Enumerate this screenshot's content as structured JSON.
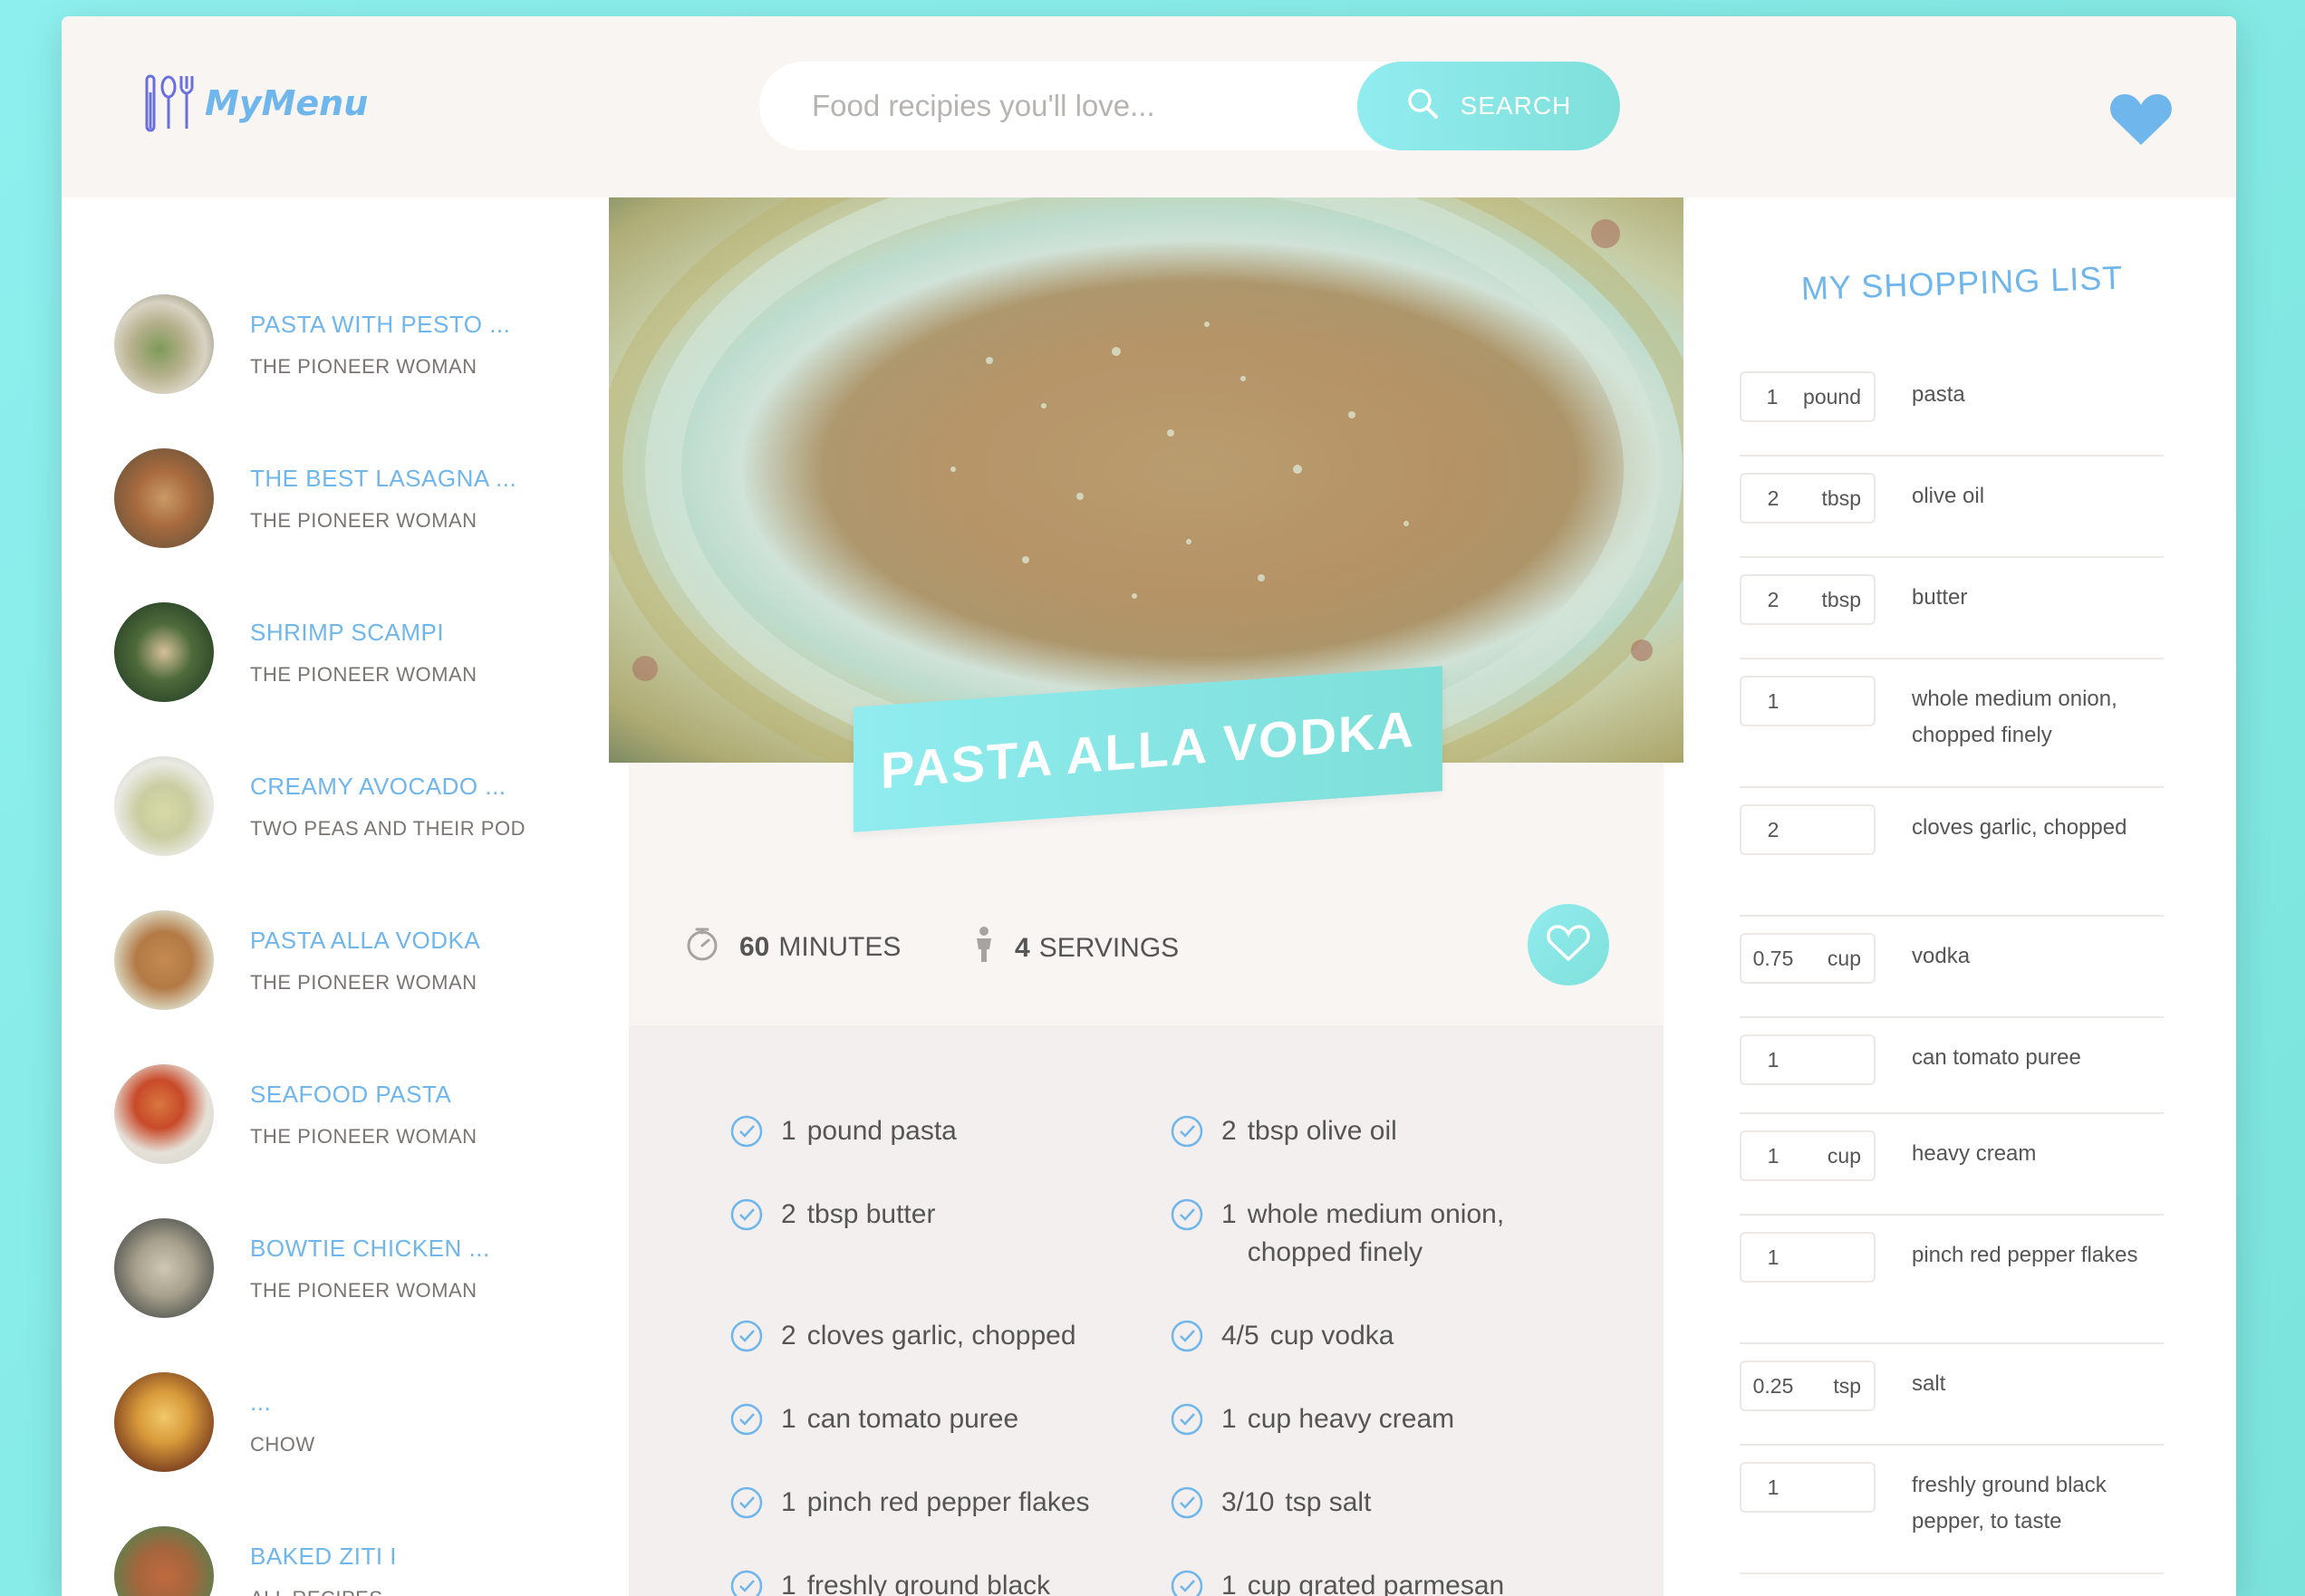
{
  "header": {
    "logo_text": "MyMenu",
    "search_placeholder": "Food recipies you'll love...",
    "search_button": "SEARCH"
  },
  "results": [
    {
      "title": "PASTA WITH PESTO ...",
      "publisher": "THE PIONEER WOMAN"
    },
    {
      "title": "THE BEST LASAGNA ...",
      "publisher": "THE PIONEER WOMAN"
    },
    {
      "title": "SHRIMP SCAMPI",
      "publisher": "THE PIONEER WOMAN"
    },
    {
      "title": "CREAMY AVOCADO ...",
      "publisher": "TWO PEAS AND THEIR POD"
    },
    {
      "title": "PASTA ALLA VODKA",
      "publisher": "THE PIONEER WOMAN"
    },
    {
      "title": "SEAFOOD PASTA",
      "publisher": "THE PIONEER WOMAN"
    },
    {
      "title": "BOWTIE CHICKEN ...",
      "publisher": "THE PIONEER WOMAN"
    },
    {
      "title": "...",
      "publisher": "CHOW"
    },
    {
      "title": "BAKED ZITI I",
      "publisher": "ALL RECIPES"
    }
  ],
  "recipe": {
    "title": "PASTA ALLA VODKA",
    "minutes": "60",
    "minutes_label": "MINUTES",
    "servings": "4",
    "servings_label": "SERVINGS",
    "ingredients": [
      {
        "count": "1",
        "text": "pound pasta"
      },
      {
        "count": "2",
        "text": "tbsp olive oil"
      },
      {
        "count": "2",
        "text": "tbsp butter"
      },
      {
        "count": "1",
        "text": "whole medium onion, chopped finely"
      },
      {
        "count": "2",
        "text": "cloves garlic, chopped"
      },
      {
        "count": "4/5",
        "text": "cup vodka"
      },
      {
        "count": "1",
        "text": "can tomato puree"
      },
      {
        "count": "1",
        "text": "cup heavy cream"
      },
      {
        "count": "1",
        "text": "pinch red pepper flakes"
      },
      {
        "count": "3/10",
        "text": "tsp salt"
      },
      {
        "count": "1",
        "text": "freshly ground black"
      },
      {
        "count": "1",
        "text": "cup grated parmesan"
      }
    ]
  },
  "shopping": {
    "title": "MY SHOPPING LIST",
    "items": [
      {
        "count": "1",
        "unit": "pound",
        "name": "pasta"
      },
      {
        "count": "2",
        "unit": "tbsp",
        "name": "olive oil"
      },
      {
        "count": "2",
        "unit": "tbsp",
        "name": "butter"
      },
      {
        "count": "1",
        "unit": "",
        "name": "whole medium onion, chopped finely"
      },
      {
        "count": "2",
        "unit": "",
        "name": "cloves garlic, chopped"
      },
      {
        "count": "0.75",
        "unit": "cup",
        "name": "vodka"
      },
      {
        "count": "1",
        "unit": "",
        "name": "can tomato puree"
      },
      {
        "count": "1",
        "unit": "cup",
        "name": "heavy cream"
      },
      {
        "count": "1",
        "unit": "",
        "name": "pinch red pepper flakes"
      },
      {
        "count": "0.25",
        "unit": "tsp",
        "name": "salt"
      },
      {
        "count": "1",
        "unit": "",
        "name": "freshly ground black pepper, to taste"
      }
    ]
  },
  "colors": {
    "accent": "#6fb6ec",
    "gradient_start": "#91ecef",
    "gradient_end": "#7fe0da",
    "panel_bg": "#f8f5f3"
  },
  "icons": [
    "cutlery-icon",
    "search-icon",
    "heart-icon",
    "timer-icon",
    "person-icon",
    "heart-outline-icon",
    "check-circle-icon"
  ]
}
